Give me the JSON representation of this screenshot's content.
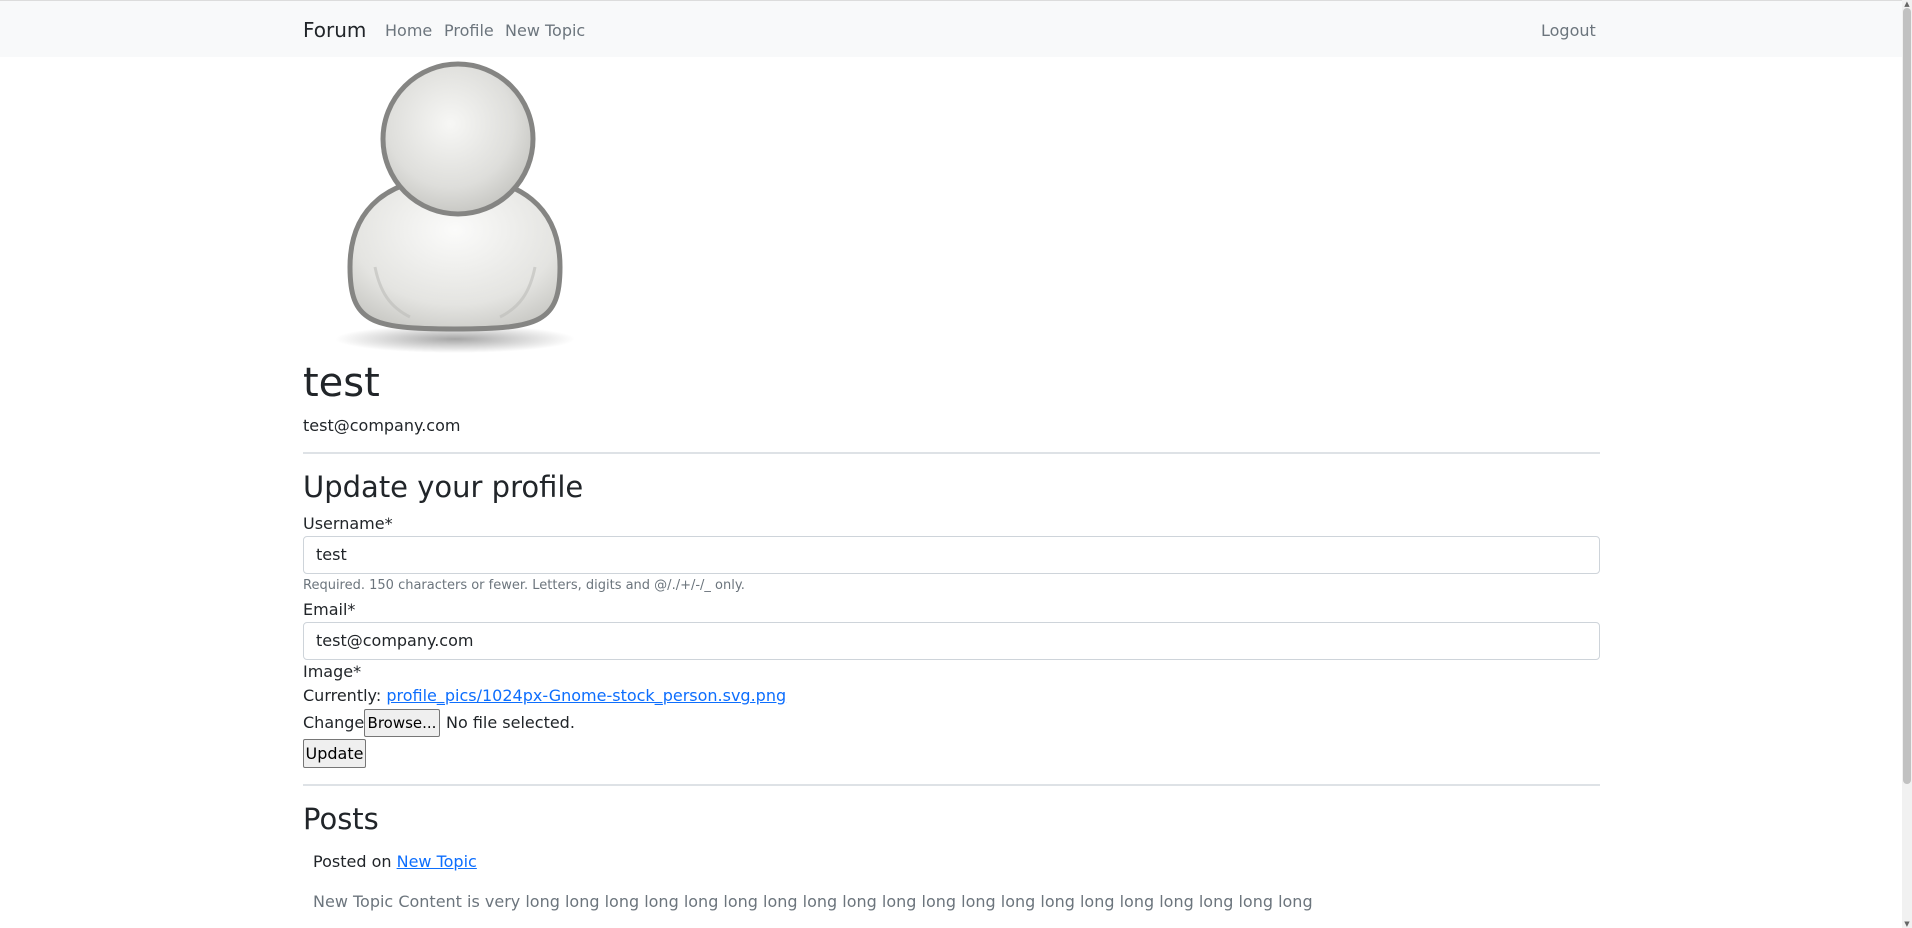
{
  "nav": {
    "brand": "Forum",
    "home": "Home",
    "profile": "Profile",
    "new_topic": "New Topic",
    "logout": "Logout"
  },
  "profile": {
    "avatar_icon": "person-avatar-icon",
    "username": "test",
    "email": "test@company.com"
  },
  "update_form": {
    "title": "Update your profile",
    "username_label": "Username*",
    "username_value": "test",
    "username_help": "Required. 150 characters or fewer. Letters, digits and @/./+/-/_ only.",
    "email_label": "Email*",
    "email_value": "test@company.com",
    "image_label": "Image*",
    "currently_label": "Currently:",
    "currently_link": "profile_pics/1024px-Gnome-stock_person.svg.png",
    "change_label": "Change:",
    "browse_label": "Browse...",
    "no_file_text": "No file selected.",
    "update_button": "Update"
  },
  "posts": {
    "title": "Posts",
    "items": [
      {
        "posted_on_label": "Posted on",
        "topic_link": "New Topic",
        "content": "New Topic Content is very long long long long long long long long long long long long long long long long long long long long v"
      }
    ]
  },
  "colors": {
    "navbar_bg": "#f8f9fa",
    "link": "#0d6efd",
    "muted": "#6c757d",
    "text": "#212529"
  }
}
